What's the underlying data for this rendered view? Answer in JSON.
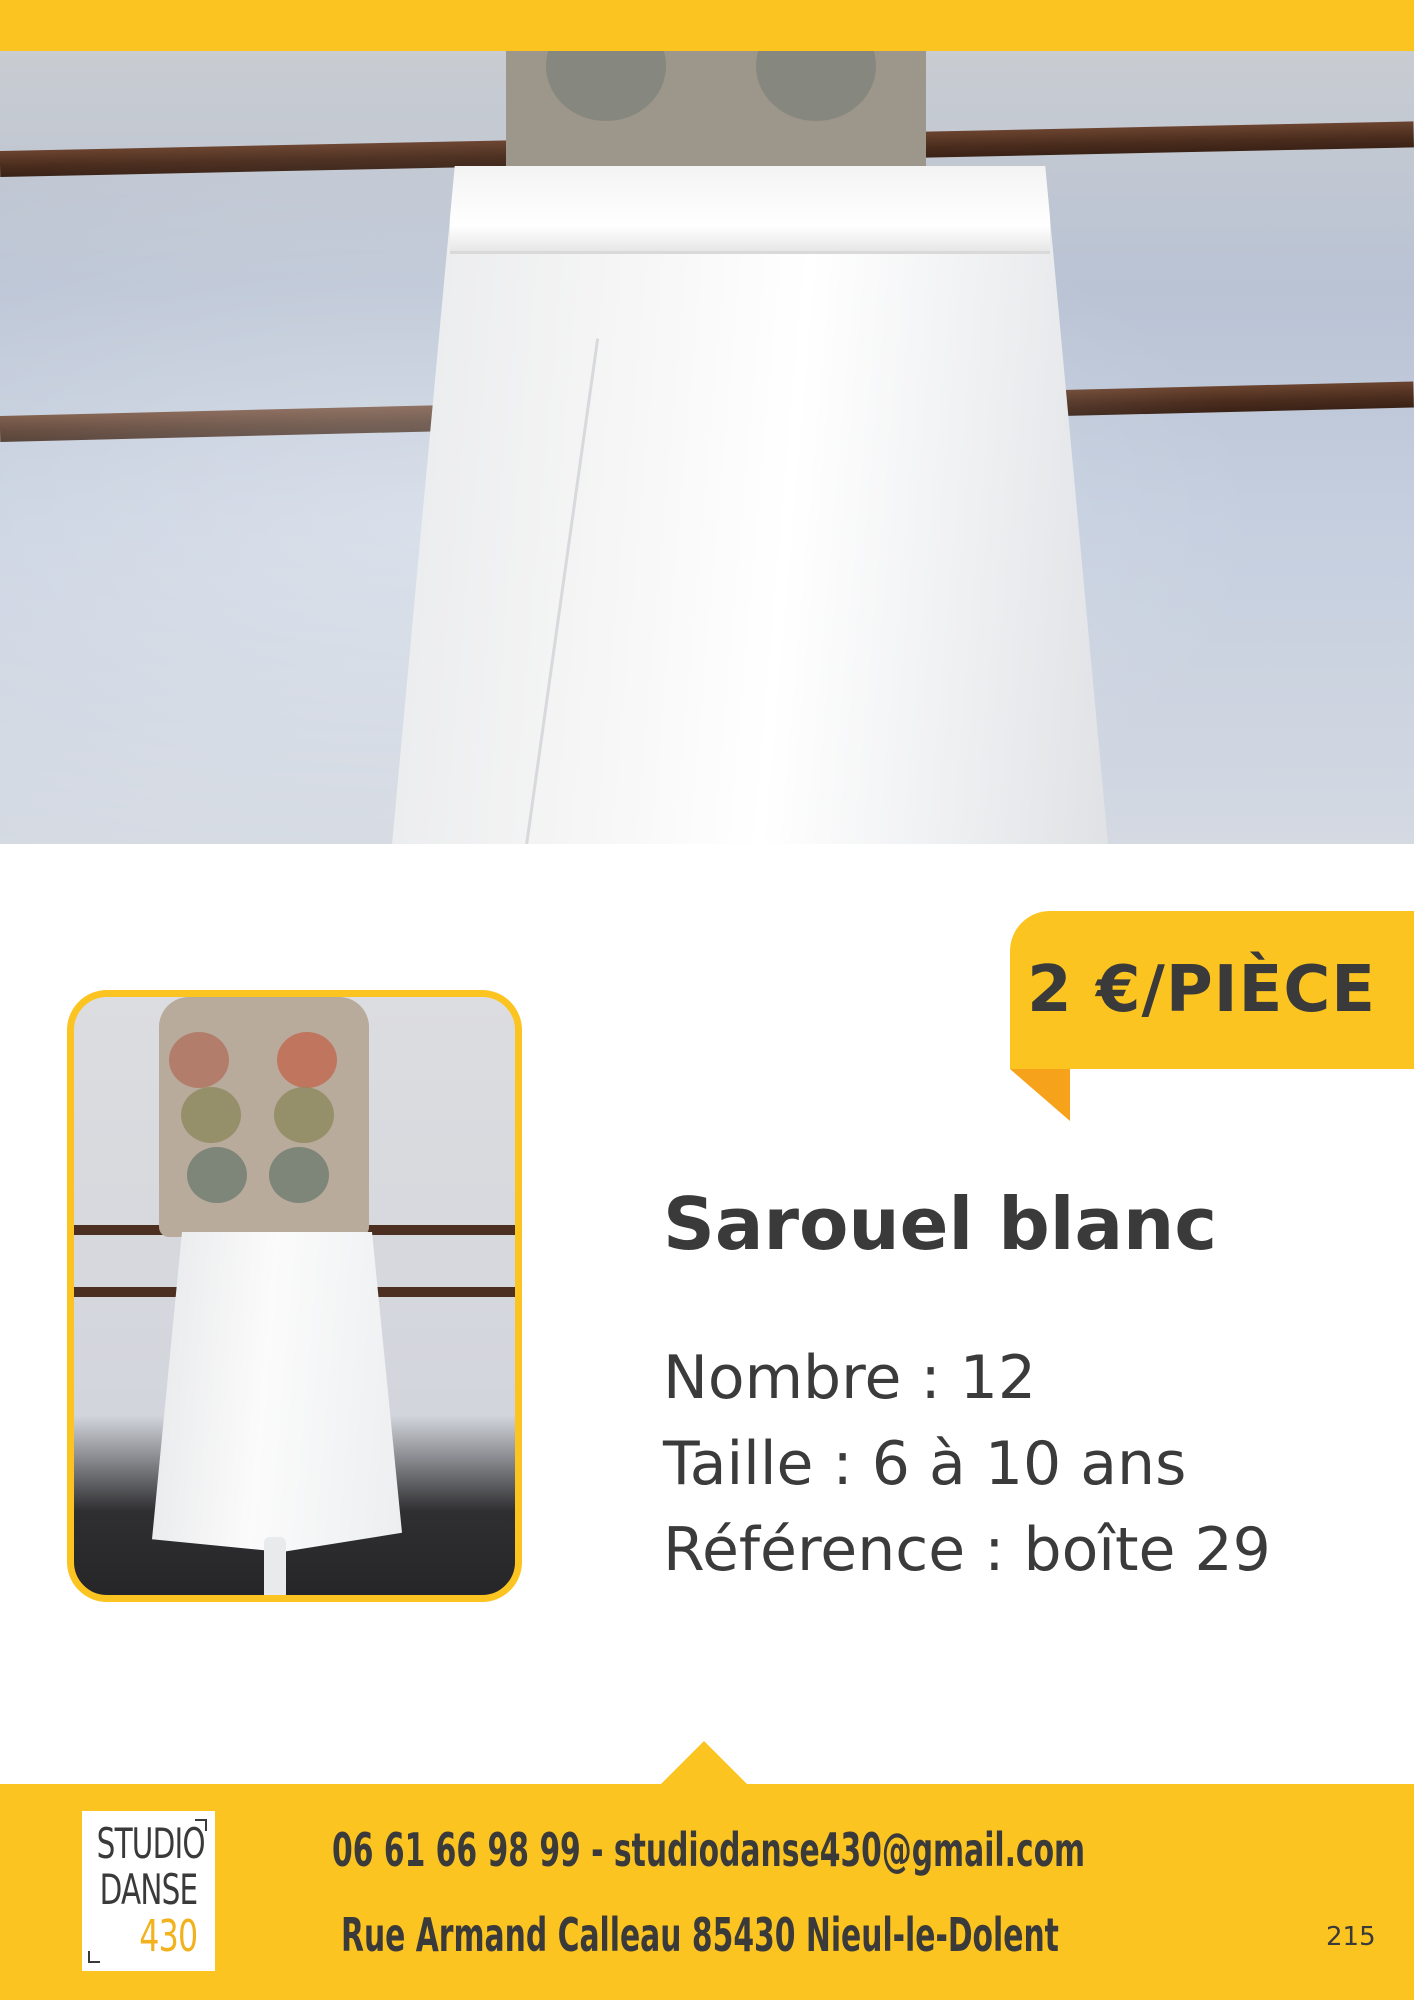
{
  "price": {
    "label": "2 €/PIÈCE"
  },
  "product": {
    "title": "Sarouel blanc",
    "details": [
      "Nombre : 12",
      "Taille : 6 à 10 ans",
      "Référence : boîte 29"
    ]
  },
  "footer": {
    "logo": {
      "line1": "STUDIO",
      "line2": "DANSE",
      "line3": "430"
    },
    "contact_line": "06 61 66 98 99 - studiodanse430@gmail.com",
    "address_line": "Rue Armand Calleau 85430 Nieul-le-Dolent",
    "page_number": "215"
  },
  "colors": {
    "accent": "#fcc421",
    "accent_dark": "#f7a21b",
    "text": "#3a3a3a"
  }
}
